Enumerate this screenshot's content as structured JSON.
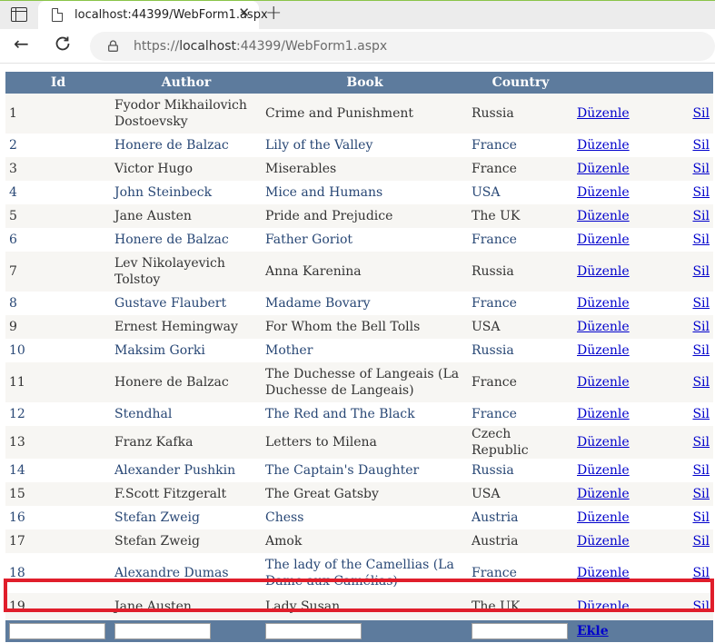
{
  "browser": {
    "tab_title": "localhost:44399/WebForm1.aspx",
    "url_scheme": "https://",
    "url_host": "localhost",
    "url_rest": ":44399/WebForm1.aspx"
  },
  "grid": {
    "headers": [
      "Id",
      "Author",
      "Book",
      "Country",
      "",
      ""
    ],
    "edit_label": "Düzenle",
    "delete_label": "Sil",
    "rows": [
      {
        "id": "1",
        "author": "Fyodor Mikhailovich Dostoevsky",
        "book": "Crime and Punishment",
        "country": "Russia"
      },
      {
        "id": "2",
        "author": "Honere de Balzac",
        "book": "Lily of the Valley",
        "country": "France"
      },
      {
        "id": "3",
        "author": "Victor Hugo",
        "book": "Miserables",
        "country": "France"
      },
      {
        "id": "4",
        "author": "John Steinbeck",
        "book": "Mice and Humans",
        "country": "USA"
      },
      {
        "id": "5",
        "author": "Jane Austen",
        "book": "Pride and Prejudice",
        "country": "The UK"
      },
      {
        "id": "6",
        "author": "Honere de Balzac",
        "book": "Father Goriot",
        "country": "France"
      },
      {
        "id": "7",
        "author": "Lev Nikolayevich Tolstoy",
        "book": "Anna Karenina",
        "country": "Russia"
      },
      {
        "id": "8",
        "author": "Gustave Flaubert",
        "book": "Madame Bovary",
        "country": "France"
      },
      {
        "id": "9",
        "author": "Ernest Hemingway",
        "book": "For Whom the Bell Tolls",
        "country": "USA"
      },
      {
        "id": "10",
        "author": "Maksim Gorki",
        "book": "Mother",
        "country": "Russia"
      },
      {
        "id": "11",
        "author": "Honere de Balzac",
        "book": "The Duchesse of Langeais (La Duchesse de Langeais)",
        "country": "France"
      },
      {
        "id": "12",
        "author": "Stendhal",
        "book": "The Red and The Black",
        "country": "France"
      },
      {
        "id": "13",
        "author": "Franz Kafka",
        "book": "Letters to Milena",
        "country": "Czech Republic"
      },
      {
        "id": "14",
        "author": "Alexander Pushkin",
        "book": "The Captain's Daughter",
        "country": "Russia"
      },
      {
        "id": "15",
        "author": "F.Scott Fitzgeralt",
        "book": "The Great Gatsby",
        "country": "USA"
      },
      {
        "id": "16",
        "author": "Stefan Zweig",
        "book": "Chess",
        "country": "Austria"
      },
      {
        "id": "17",
        "author": "Stefan Zweig",
        "book": "Amok",
        "country": "Austria"
      },
      {
        "id": "18",
        "author": "Alexandre Dumas",
        "book": "The lady of the Camellias (La Dame aux Camélias)",
        "country": "France"
      },
      {
        "id": "19",
        "author": "Jane Austen",
        "book": "Lady Susan",
        "country": "The UK"
      }
    ],
    "footer": {
      "add_label": "Ekle"
    }
  },
  "colors": {
    "header_bg": "#5d7b9d",
    "odd_row": "#f7f6f3",
    "highlight": "#e01e2b",
    "link": "#0000cc"
  }
}
